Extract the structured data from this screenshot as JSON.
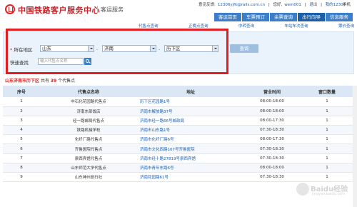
{
  "header": {
    "title": "中国铁路客户服务中心",
    "subtitle": "客运服务",
    "top_links": {
      "feedback_label": "意见反馈:",
      "feedback_email": "12306yjfk@rails.com.cn",
      "welcome": "您好,",
      "username": "wem001",
      "separator": "|",
      "logout": "退出",
      "my_label": "我的12306",
      "mobile": "手机"
    }
  },
  "nav": {
    "items": [
      {
        "label": "客运首页",
        "active": false
      },
      {
        "label": "车票预订",
        "active": false
      },
      {
        "label": "余票查询",
        "active": false
      },
      {
        "label": "出行向导",
        "active": true
      },
      {
        "label": "信息服务",
        "active": false
      }
    ]
  },
  "subnav": {
    "items": [
      "代售点查询",
      "正晚点查询",
      "中转查询",
      "车站车次查询",
      "票价查询"
    ]
  },
  "search": {
    "region_label": "所在地区",
    "required_mark": "*",
    "province": "山东",
    "city": "济南",
    "district": "历下区",
    "query_button": "查询",
    "quick_label": "快速查找",
    "quick_placeholder": "输入代售点名称"
  },
  "summary": {
    "location": "山东济南市历下区",
    "prefix": "共有",
    "count": "39",
    "suffix": "个代售点"
  },
  "table": {
    "headers": [
      "序号",
      "代售点名称",
      "地址",
      "营业时间",
      "窗口数量"
    ],
    "rows": [
      [
        "1",
        "中石化花园路代售点",
        "历下区花园路1号",
        "08:00-18:00",
        "1"
      ],
      [
        "2",
        "济南东部饭店",
        "济南市解放路37号",
        "08:00-18:00",
        "1"
      ],
      [
        "3",
        "经一路邮局代售点",
        "济南市经一路66号邮政局",
        "08:00-17:30",
        "1"
      ],
      [
        "4",
        "铁路机械学校",
        "济南市山东路1号",
        "07:30-18:30",
        "1"
      ],
      [
        "5",
        "化纤厂路代售点",
        "济南市化纤厂路6号",
        "08:00-17:30",
        "1"
      ],
      [
        "6",
        "齐鲁医院代售点",
        "济南市文化西路107号齐鲁医院",
        "07:30-18:30",
        "1"
      ],
      [
        "7",
        "泉西宾馆代售点",
        "济南市经十路27819号泉西宾馆",
        "07:30-18:30",
        "1"
      ],
      [
        "8",
        "山东师范大学代售点",
        "济南市青年东路6号",
        "08:00-18:00",
        "1"
      ],
      [
        "9",
        "山东神州旅行社",
        "济南花园路61号",
        "07:30-18:30",
        "1"
      ]
    ]
  },
  "watermark": {
    "brand": "Baidu经验",
    "url": "jingyan.baidu.com"
  }
}
